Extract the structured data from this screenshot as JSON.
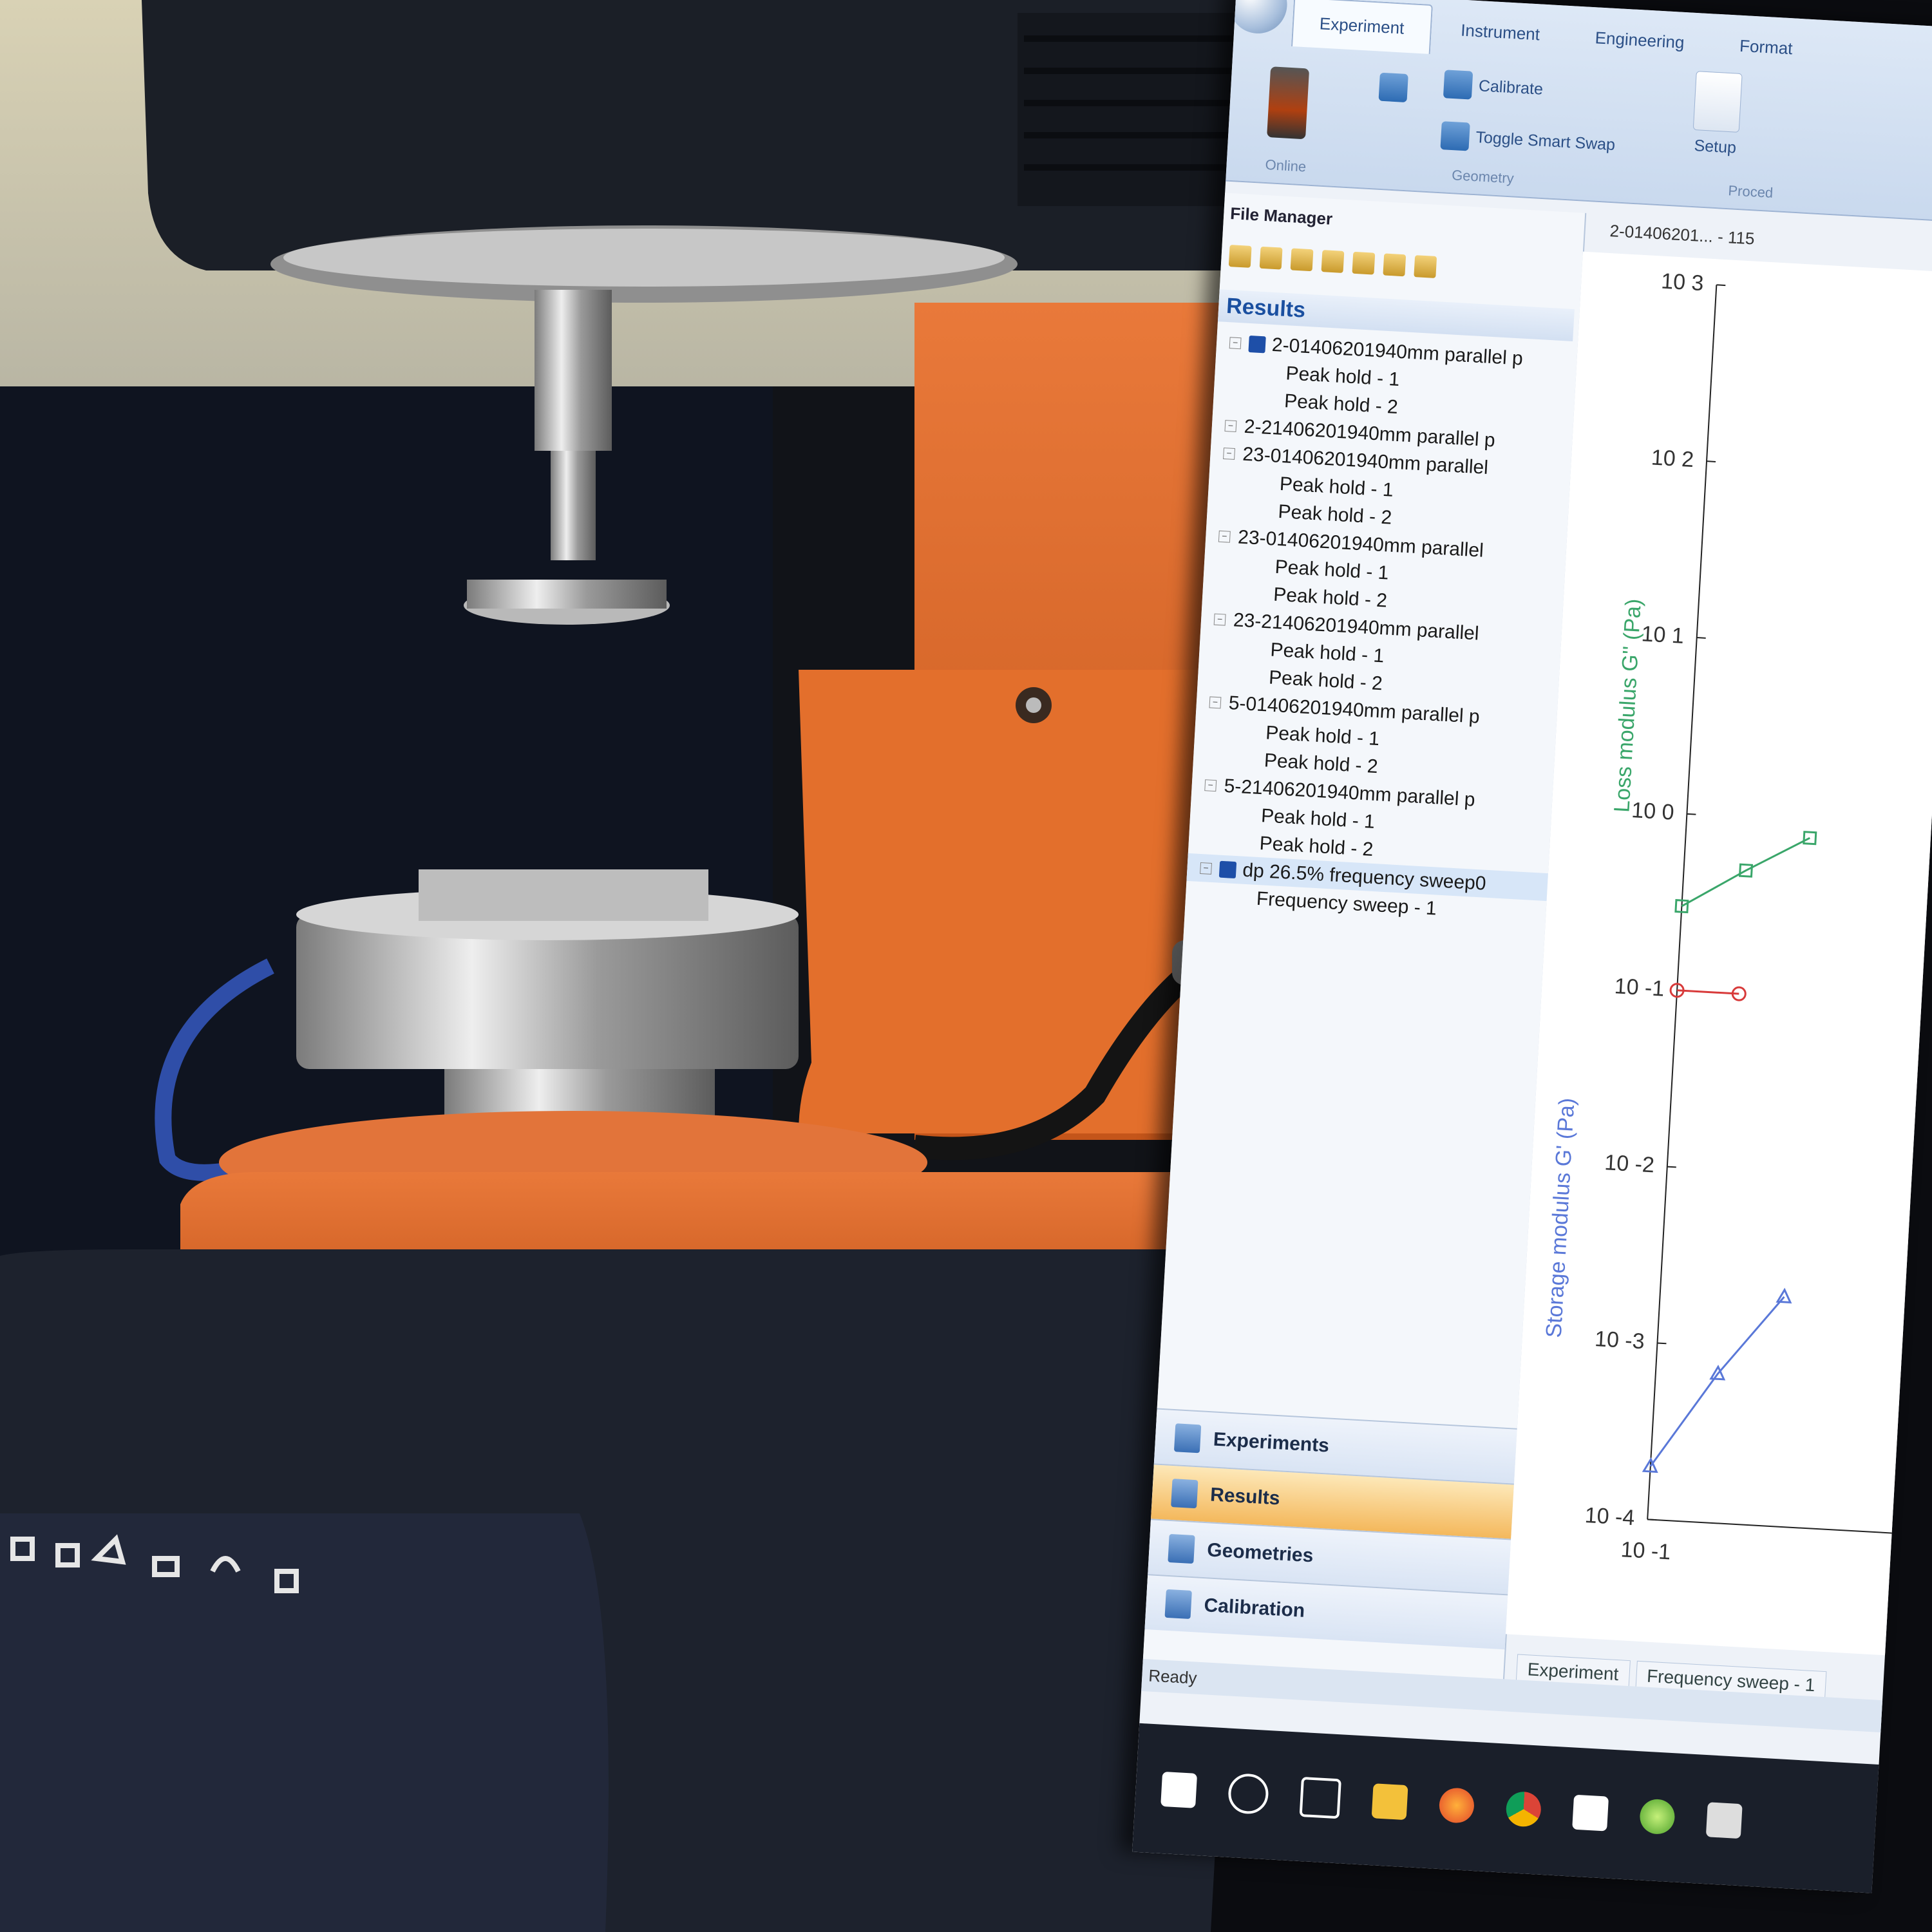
{
  "ribbon": {
    "tabs": [
      "Experiment",
      "Instrument",
      "Engineering",
      "Format"
    ],
    "buttons": {
      "calibrate": "Calibrate",
      "toggle_smart_swap": "Toggle Smart Swap",
      "setup": "Setup"
    },
    "groups": {
      "online": "Online",
      "geometry": "Geometry",
      "procedure": "Proced"
    }
  },
  "file_manager": {
    "title": "File Manager",
    "results_header": "Results",
    "tree": [
      {
        "label": "2-01406201940mm parallel p",
        "level": 0
      },
      {
        "label": "Peak hold - 1",
        "level": 1
      },
      {
        "label": "Peak hold - 2",
        "level": 1
      },
      {
        "label": "2-21406201940mm parallel p",
        "level": 0
      },
      {
        "label": "23-01406201940mm parallel",
        "level": 0
      },
      {
        "label": "Peak hold - 1",
        "level": 1
      },
      {
        "label": "Peak hold - 2",
        "level": 1
      },
      {
        "label": "23-01406201940mm parallel",
        "level": 0
      },
      {
        "label": "Peak hold - 1",
        "level": 1
      },
      {
        "label": "Peak hold - 2",
        "level": 1
      },
      {
        "label": "23-21406201940mm parallel",
        "level": 0
      },
      {
        "label": "Peak hold - 1",
        "level": 1
      },
      {
        "label": "Peak hold - 2",
        "level": 1
      },
      {
        "label": "5-01406201940mm parallel p",
        "level": 0
      },
      {
        "label": "Peak hold - 1",
        "level": 1
      },
      {
        "label": "Peak hold - 2",
        "level": 1
      },
      {
        "label": "5-21406201940mm parallel p",
        "level": 0
      },
      {
        "label": "Peak hold - 1",
        "level": 1
      },
      {
        "label": "Peak hold - 2",
        "level": 1
      },
      {
        "label": "dp 26.5% frequency sweep0",
        "level": 0,
        "selected": true
      },
      {
        "label": "Frequency sweep - 1",
        "level": 1
      }
    ]
  },
  "nav": {
    "items": [
      "Experiments",
      "Results",
      "Geometries",
      "Calibration"
    ],
    "active": "Results"
  },
  "status": "Ready",
  "document": {
    "title": "2-01406201... - 115",
    "tabs": [
      "Experiment",
      "Frequency sweep - 1"
    ]
  },
  "colors": {
    "loss": "#3aa66a",
    "storage": "#5a78d8",
    "ref": "#d83a3a",
    "orange": "#d9621f"
  },
  "chart_data": {
    "type": "scatter",
    "xlabel": "",
    "y_left_label": "Storage modulus G' (Pa)",
    "y_right_label": "Loss modulus G'' (Pa)",
    "yscale": "log",
    "y_ticks": [
      "10 3",
      "10 2",
      "10 1",
      "10 0",
      "10 -1",
      "10 -2",
      "10 -3",
      "10 -4"
    ],
    "x_ticks": [
      "10 -1"
    ],
    "series": [
      {
        "name": "Loss modulus G'' (Pa)",
        "x": [
          0.1,
          0.2,
          0.4
        ],
        "values": [
          0.3,
          0.5,
          0.8
        ]
      },
      {
        "name": "",
        "x": [
          0.1,
          0.2
        ],
        "values": [
          0.1,
          0.1
        ]
      },
      {
        "name": "Storage modulus G' (Pa)",
        "x": [
          0.1,
          0.2,
          0.4
        ],
        "values": [
          0.0002,
          0.0007,
          0.002
        ]
      }
    ]
  }
}
